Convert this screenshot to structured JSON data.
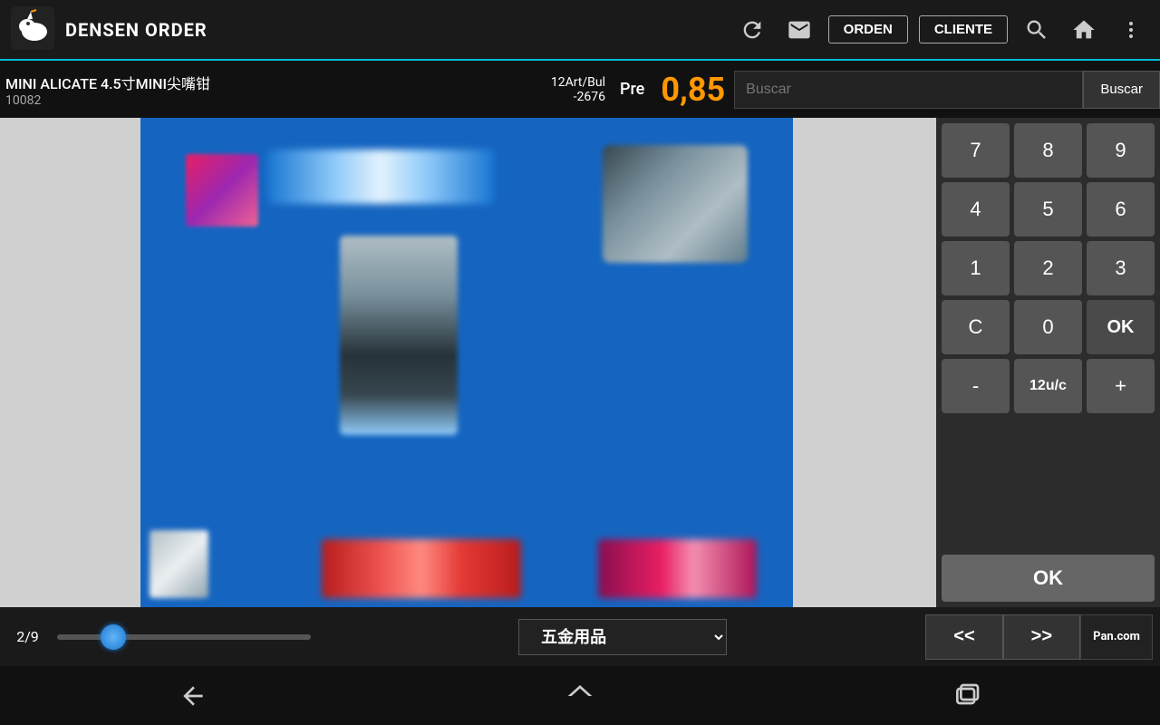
{
  "app": {
    "title": "DENSEN ORDER",
    "logo_alt": "unicorn-logo"
  },
  "header": {
    "btn_orden": "ORDEN",
    "btn_cliente": "CLIENTE",
    "refresh_icon": "refresh-icon",
    "mail_icon": "mail-icon",
    "search_icon": "search-icon",
    "home_icon": "home-icon",
    "more_icon": "more-icon"
  },
  "product_bar": {
    "name": "MINI ALICATE 4.5寸MINI尖嘴钳",
    "code": "10082",
    "qty_line1": "12Art/Bul",
    "qty_line2": "-2676",
    "pre_label": "Pre",
    "price": "0,85",
    "search_placeholder": "Buscar",
    "buscar_btn": "Buscar"
  },
  "numpad": {
    "buttons": [
      [
        "7",
        "8",
        "9"
      ],
      [
        "4",
        "5",
        "6"
      ],
      [
        "1",
        "2",
        "3"
      ],
      [
        "C",
        "0",
        "OK"
      ]
    ],
    "bottom_row": [
      "-",
      "12u/c",
      "+"
    ],
    "ok_large": "OK"
  },
  "bottom_bar": {
    "page_counter": "2/9",
    "category": "五金用品",
    "prev_btn": "<<",
    "next_btn": ">>",
    "pan_btn": "Pan.com"
  },
  "android_nav": {
    "back_icon": "back-icon",
    "home_icon": "home-icon",
    "recents_icon": "recents-icon"
  }
}
